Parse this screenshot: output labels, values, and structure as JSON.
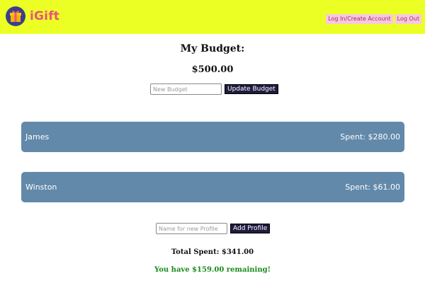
{
  "header": {
    "brand": "iGift",
    "logo_icon": "gift-icon",
    "nav": {
      "login_label": "Log In/Create Account",
      "logout_label": "Log Out"
    },
    "colors": {
      "bar": "#ecff24",
      "brand": "#e8537e",
      "nav_bg": "#f6c9df",
      "nav_text": "#b0246a"
    }
  },
  "budget": {
    "title": "My Budget:",
    "amount": "$500.00",
    "input_placeholder": "New Budget",
    "update_label": "Update Budget"
  },
  "profiles": [
    {
      "name": "James",
      "spent": "Spent: $280.00"
    },
    {
      "name": "Winston",
      "spent": "Spent: $61.00"
    }
  ],
  "add_profile": {
    "input_placeholder": "Name for new Profile",
    "button_label": "Add Profile"
  },
  "summary": {
    "total_spent": "Total Spent: $341.00",
    "remaining": "You have $159.00 remaining!",
    "remaining_color": "#1a8a1a"
  },
  "colors": {
    "card": "#6289aa",
    "button": "#1f1b3f"
  }
}
